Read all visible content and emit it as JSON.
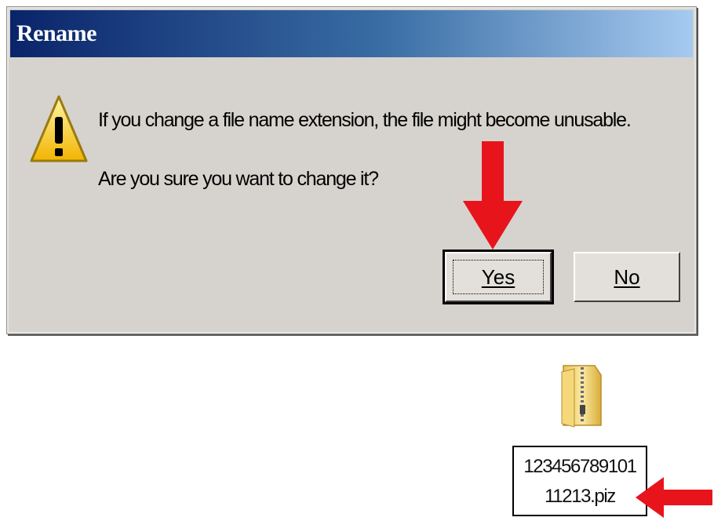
{
  "dialog": {
    "title": "Rename",
    "message_line1": "If you change a file name extension, the file might become unusable.",
    "message_line2": "Are you sure you want to change it?",
    "buttons": {
      "yes_label": "Yes",
      "no_label": "No"
    },
    "icon": "warning-icon"
  },
  "file": {
    "icon": "zip-folder-icon",
    "name_line1": "123456789101",
    "name_line2": "11213.piz"
  },
  "annotations": {
    "arrow_color": "#e8141c"
  }
}
